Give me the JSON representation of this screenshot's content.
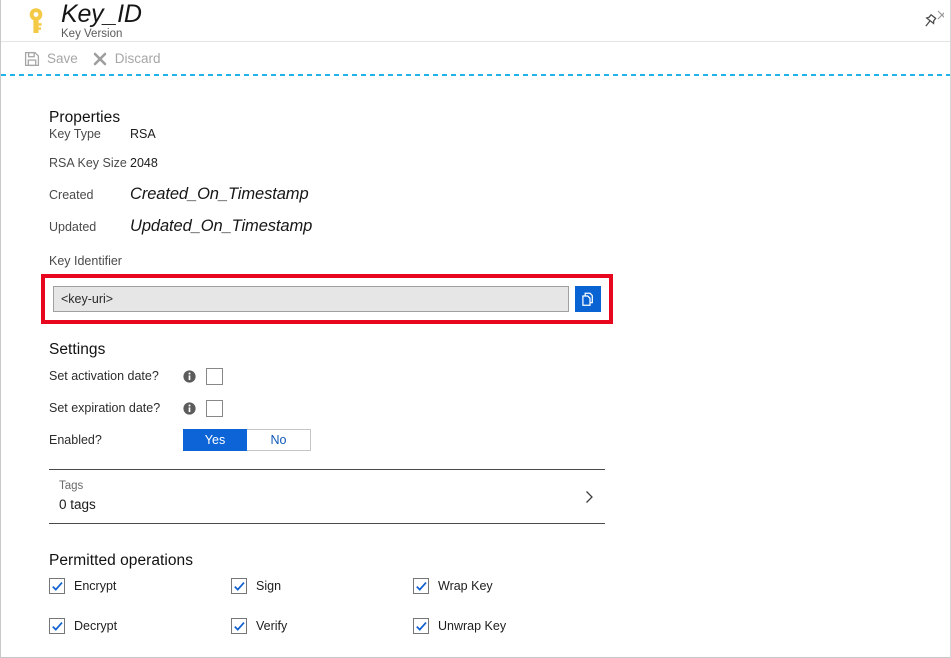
{
  "header": {
    "icon": "key-icon",
    "title": "Key_ID",
    "subtitle": "Key Version",
    "pin_icon": "pin-icon"
  },
  "command_bar": {
    "save_label": "Save",
    "save_icon": "save-floppy-icon",
    "discard_label": "Discard",
    "discard_icon": "close-x-icon"
  },
  "properties": {
    "heading": "Properties",
    "rows": [
      {
        "label": "Key Type",
        "value": "RSA",
        "placeholder_style": false
      },
      {
        "label": "RSA Key Size",
        "value": "2048",
        "placeholder_style": false
      },
      {
        "label": "Created",
        "value": "Created_On_Timestamp",
        "placeholder_style": true
      },
      {
        "label": "Updated",
        "value": "Updated_On_Timestamp",
        "placeholder_style": true
      }
    ],
    "key_identifier_label": "Key Identifier",
    "key_identifier_value": "<key-uri>",
    "copy_icon": "copy-icon",
    "highlight_color": "#e8071e"
  },
  "settings": {
    "heading": "Settings",
    "activation": {
      "label": "Set activation date?",
      "info_icon": "info-icon",
      "checked": false
    },
    "expiration": {
      "label": "Set expiration date?",
      "info_icon": "info-icon",
      "checked": false
    },
    "enabled": {
      "label": "Enabled?",
      "yes_label": "Yes",
      "no_label": "No",
      "selected": "Yes"
    }
  },
  "tags": {
    "title": "Tags",
    "count_text": "0 tags",
    "chevron_icon": "chevron-right-icon"
  },
  "permitted_operations": {
    "heading": "Permitted operations",
    "items": [
      {
        "label": "Encrypt",
        "checked": true
      },
      {
        "label": "Sign",
        "checked": true
      },
      {
        "label": "Wrap Key",
        "checked": true
      },
      {
        "label": "Decrypt",
        "checked": true
      },
      {
        "label": "Verify",
        "checked": true
      },
      {
        "label": "Unwrap Key",
        "checked": true
      }
    ]
  },
  "colors": {
    "accent_blue": "#0c64d6",
    "dotted_rule": "#22b3e6",
    "key_yellow": "#f2c230",
    "highlight_red": "#e8071e",
    "copy_button_blue": "#0a63d2"
  }
}
